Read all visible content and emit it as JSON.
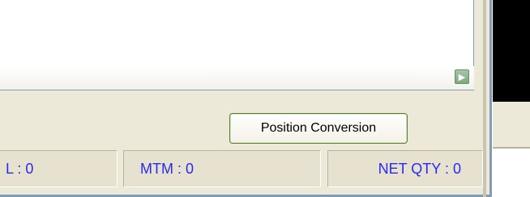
{
  "scroll": {
    "right_arrow_icon": "▶"
  },
  "actions": {
    "position_conversion_label": "Position Conversion"
  },
  "status": {
    "l_label": "L : 0",
    "mtm_label": "MTM : 0",
    "net_qty_label": "NET QTY : 0"
  },
  "colors": {
    "status_text": "#2a2af0",
    "window_bg": "#ece9d8",
    "button_border": "#5a7d3c"
  }
}
